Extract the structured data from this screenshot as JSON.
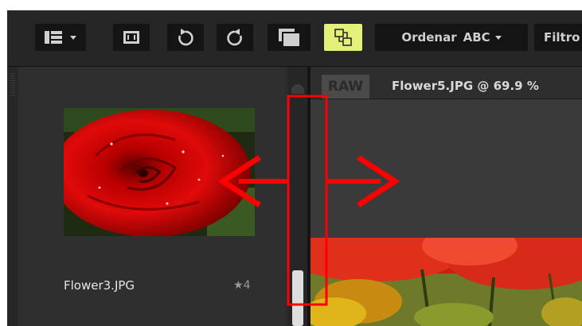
{
  "toolbar": {
    "sort_label": "Ordenar",
    "sort_value": "ABC",
    "filter_label": "Filtro",
    "buttons": [
      {
        "icon": "view-layout-icon"
      },
      {
        "icon": "fullscreen-icon"
      },
      {
        "icon": "rotate-left-icon"
      },
      {
        "icon": "rotate-right-icon"
      },
      {
        "icon": "compare-windows-icon"
      },
      {
        "icon": "sync-icon",
        "active": true
      }
    ]
  },
  "browser": {
    "thumbnail": {
      "filename": "Flower3.JPG",
      "rating": "4",
      "rating_icon": "star-icon"
    }
  },
  "viewer": {
    "raw_badge": "RAW",
    "title": "Flower5.JPG @ 69.9 %"
  },
  "annotation": {
    "color": "#ff0000",
    "description_icon": "double-arrow-icon"
  },
  "colors": {
    "accent_active": "#e3f07a",
    "toolbar_bg": "#262626",
    "panel_bg": "#2f2f2f"
  }
}
